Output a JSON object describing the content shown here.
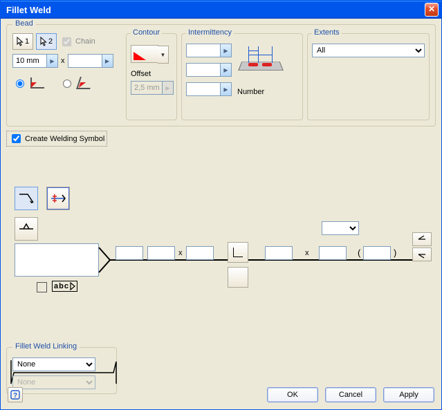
{
  "window": {
    "title": "Fillet Weld"
  },
  "bead": {
    "legend": "Bead",
    "sel1": "1",
    "sel2": "2",
    "chain_label": "Chain",
    "chain_checked": true,
    "size_value": "10 mm",
    "sep": "x"
  },
  "contour": {
    "legend": "Contour",
    "offset_label": "Offset",
    "offset_value": "2,5 mm"
  },
  "intermittency": {
    "legend": "Intermittency",
    "number_label": "Number",
    "field1": "",
    "field2": "",
    "field3": ""
  },
  "extents": {
    "legend": "Extents",
    "value": "All"
  },
  "create_symbol": {
    "label": "Create Welding Symbol",
    "checked": true
  },
  "symbol": {
    "combo_value": "",
    "paren_open": "(",
    "paren_close": ")",
    "sep": "x",
    "abc": "abc"
  },
  "linking": {
    "legend": "Fillet Weld Linking",
    "primary": "None",
    "secondary": "None"
  },
  "buttons": {
    "ok": "OK",
    "cancel": "Cancel",
    "apply": "Apply",
    "help": "?"
  }
}
